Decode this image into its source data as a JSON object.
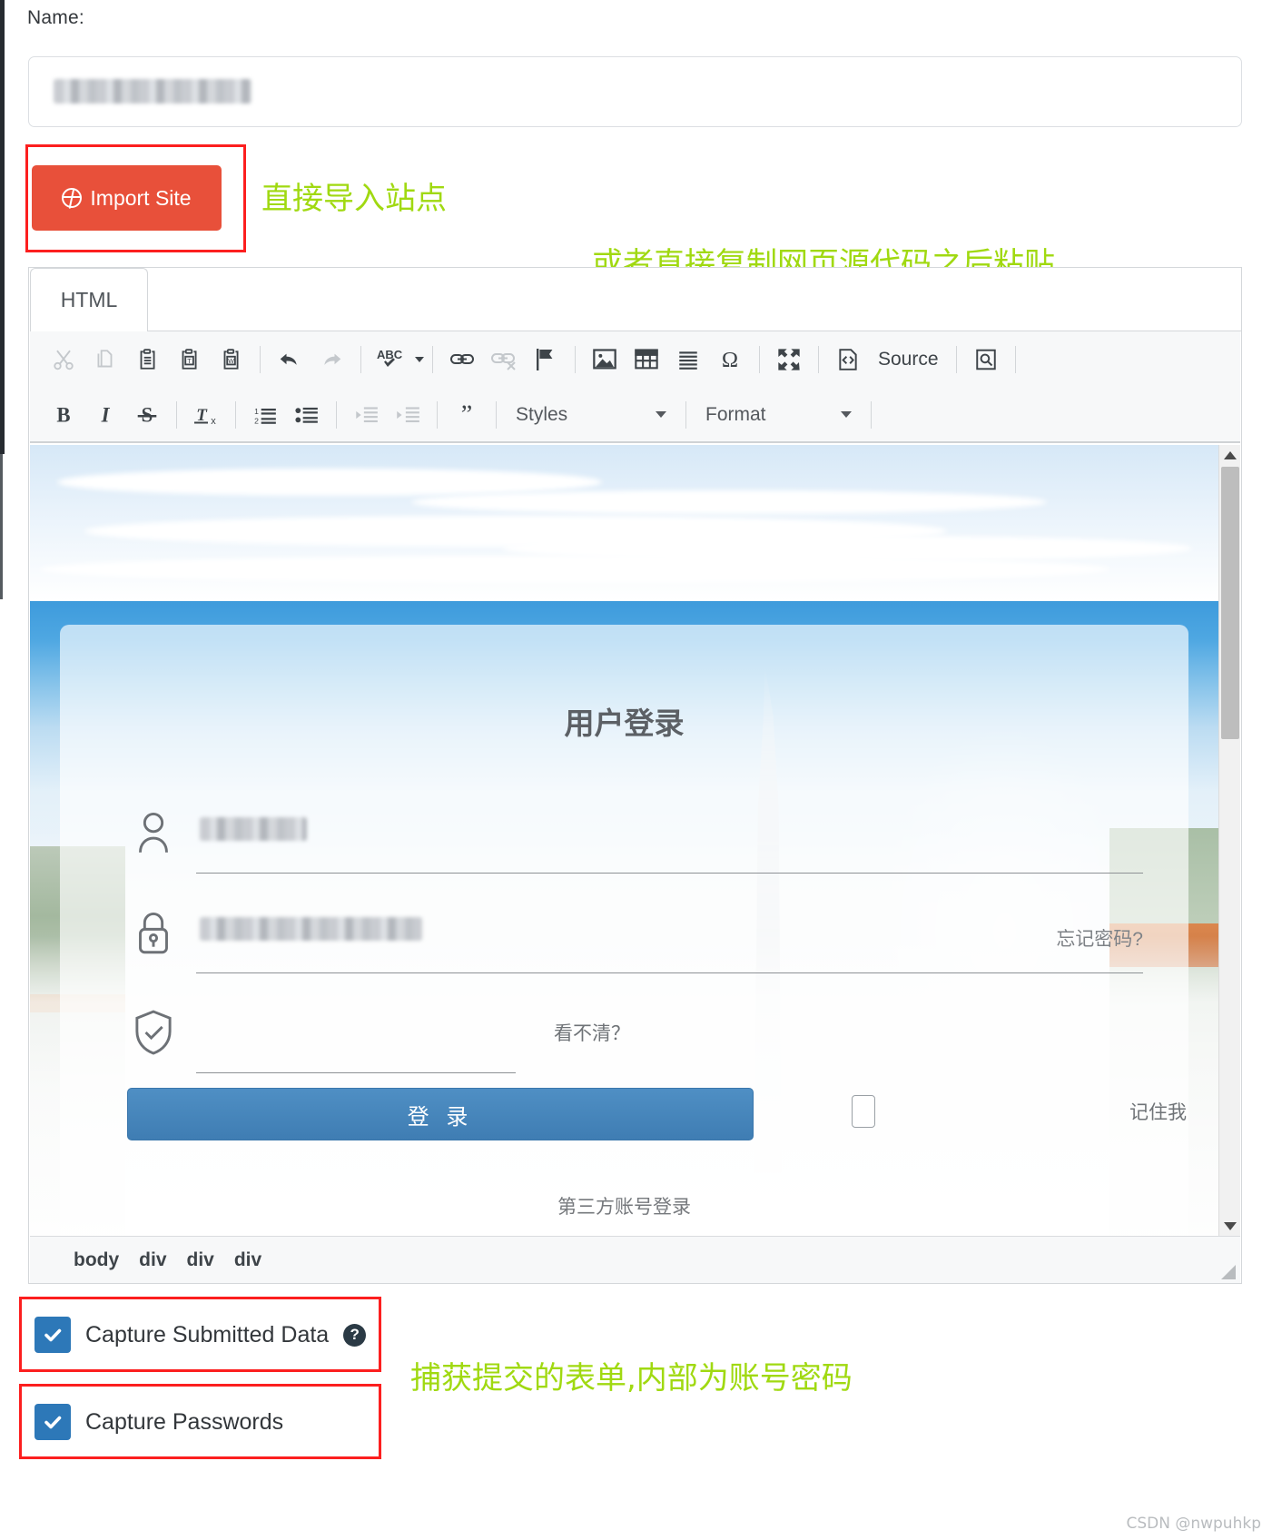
{
  "form": {
    "name_label": "Name:",
    "name_value": "",
    "import_button": "Import Site"
  },
  "annotations": [
    {
      "text": "直接导入站点"
    },
    {
      "text": "或者直接复制网页源代码之后粘贴"
    },
    {
      "text": "捕获提交的表单,内部为账号密码"
    }
  ],
  "editor": {
    "tab_label": "HTML",
    "toolbar_row1": [
      {
        "name": "cut-icon",
        "label": "Cut"
      },
      {
        "name": "copy-icon",
        "label": "Copy"
      },
      {
        "name": "paste-icon",
        "label": "Paste"
      },
      {
        "name": "paste-text-icon",
        "label": "Paste as plain text"
      },
      {
        "name": "paste-word-icon",
        "label": "Paste from Word"
      },
      {
        "name": "undo-icon",
        "label": "Undo"
      },
      {
        "name": "redo-icon",
        "label": "Redo"
      },
      {
        "name": "spellcheck-icon",
        "label": "ABC"
      },
      {
        "name": "link-icon",
        "label": "Link"
      },
      {
        "name": "unlink-icon",
        "label": "Unlink"
      },
      {
        "name": "anchor-flag-icon",
        "label": "Anchor"
      },
      {
        "name": "image-icon",
        "label": "Image"
      },
      {
        "name": "table-icon",
        "label": "Table"
      },
      {
        "name": "horizontal-rule-icon",
        "label": "Horizontal line"
      },
      {
        "name": "omega-icon",
        "label": "Special character"
      },
      {
        "name": "maximize-icon",
        "label": "Maximize"
      },
      {
        "name": "source-icon",
        "label": "Source"
      },
      {
        "name": "preview-icon",
        "label": "Preview"
      }
    ],
    "toolbar_row2": [
      {
        "name": "bold-icon",
        "label": "B"
      },
      {
        "name": "italic-icon",
        "label": "I"
      },
      {
        "name": "strikethrough-icon",
        "label": "S"
      },
      {
        "name": "remove-format-icon",
        "label": "Tx"
      },
      {
        "name": "numbered-list-icon",
        "label": "Insert/Remove Numbered List"
      },
      {
        "name": "bulleted-list-icon",
        "label": "Insert/Remove Bulleted List"
      },
      {
        "name": "outdent-icon",
        "label": "Decrease Indent"
      },
      {
        "name": "indent-icon",
        "label": "Increase Indent"
      },
      {
        "name": "blockquote-icon",
        "label": "Block Quote"
      }
    ],
    "source_label": "Source",
    "styles_select": "Styles",
    "format_select": "Format",
    "path": [
      "body",
      "div",
      "div",
      "div"
    ]
  },
  "preview": {
    "title": "用户登录",
    "username_value": "",
    "password_value": "",
    "forgot_password": "忘记密码?",
    "cannot_read": "看不清？",
    "login_button": "登 录",
    "remember_me": "记住我",
    "third_party": "第三方账号登录"
  },
  "options": [
    {
      "label": "Capture Submitted Data",
      "checked": true,
      "has_help": true
    },
    {
      "label": "Capture Passwords",
      "checked": true,
      "has_help": false
    }
  ],
  "watermark": "CSDN @nwpuhkp",
  "colors": {
    "accent_red": "#e8503a",
    "highlight_red": "#fc1f1f",
    "annotation_green": "#a0d911",
    "checkbox_blue": "#2d78b8",
    "login_blue": "#4f8fc4"
  }
}
